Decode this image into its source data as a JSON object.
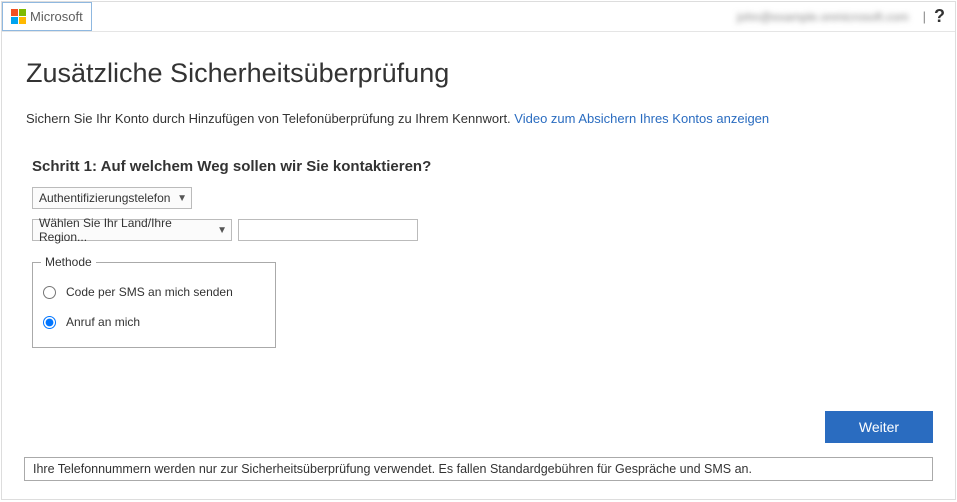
{
  "header": {
    "brand": "Microsoft",
    "user_email": "john@example.onmicrosoft.com",
    "help": "?"
  },
  "page": {
    "title": "Zusätzliche Sicherheitsüberprüfung",
    "intro_text": "Sichern Sie Ihr Konto durch Hinzufügen von Telefonüberprüfung zu Ihrem Kennwort. ",
    "intro_link": "Video zum Absichern Ihres Kontos anzeigen"
  },
  "step1": {
    "heading": "Schritt 1: Auf welchem Weg sollen wir Sie kontaktieren?",
    "contact_method_selected": "Authentifizierungstelefon",
    "region_selected": "Wählen Sie Ihr Land/Ihre Region...",
    "phone_value": "",
    "method_legend": "Methode",
    "radio_sms_label": "Code per SMS an mich senden",
    "radio_call_label": "Anruf an mich",
    "radio_selected": "call"
  },
  "buttons": {
    "next": "Weiter"
  },
  "footer": {
    "note": "Ihre Telefonnummern werden nur zur Sicherheitsüberprüfung verwendet. Es fallen Standardgebühren für Gespräche und SMS an."
  }
}
